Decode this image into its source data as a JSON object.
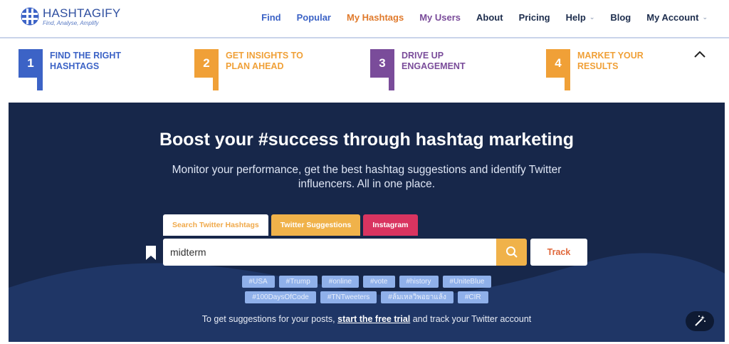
{
  "header": {
    "logo_name": "HASHTAGIFY",
    "logo_tagline": "Find, Analyse, Amplify",
    "nav": [
      {
        "label": "Find"
      },
      {
        "label": "Popular"
      },
      {
        "label": "My Hashtags"
      },
      {
        "label": "My Users"
      },
      {
        "label": "About"
      },
      {
        "label": "Pricing"
      },
      {
        "label": "Help"
      },
      {
        "label": "Blog"
      },
      {
        "label": "My Account"
      }
    ]
  },
  "steps": [
    {
      "number": "1",
      "line1": "FIND THE RIGHT",
      "line2": "HASHTAGS",
      "color": "#3c63c6"
    },
    {
      "number": "2",
      "line1": "GET INSIGHTS TO",
      "line2": "PLAN AHEAD",
      "color": "#f0a037"
    },
    {
      "number": "3",
      "line1": "DRIVE UP",
      "line2": "ENGAGEMENT",
      "color": "#7a4c9a"
    },
    {
      "number": "4",
      "line1": "MARKET YOUR",
      "line2": "RESULTS",
      "color": "#f0a037"
    }
  ],
  "hero": {
    "title": "Boost your #success through hashtag marketing",
    "subtitle": "Monitor your performance, get the best hashtag suggestions and identify Twitter influencers. All in one place.",
    "tabs": [
      {
        "label": "Search Twitter Hashtags"
      },
      {
        "label": "Twitter Suggestions"
      },
      {
        "label": "Instagram"
      }
    ],
    "search_value": "midterm",
    "track_label": "Track",
    "chips_row1": [
      "#USA",
      "#Trump",
      "#online",
      "#vote",
      "#history",
      "#UniteBlue"
    ],
    "chips_row2": [
      "#100DaysOfCode",
      "#TNTweeters",
      "#ล้มเหลวิพอยาแล้ง",
      "#CIR"
    ],
    "footer_before": "To get suggestions for your posts,",
    "footer_link": "start the free trial",
    "footer_after": "and track your Twitter account"
  },
  "colors": {
    "brand_blue": "#3c63c6",
    "accent_orange": "#f0b24a",
    "instagram_red": "#d93460",
    "hero_bg": "#17274a"
  }
}
